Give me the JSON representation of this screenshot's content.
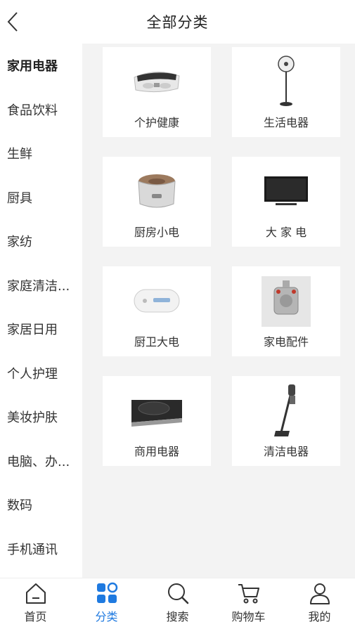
{
  "header": {
    "title": "全部分类"
  },
  "sidebar": {
    "items": [
      {
        "label": "家用电器"
      },
      {
        "label": "食品饮料"
      },
      {
        "label": "生鲜"
      },
      {
        "label": "厨具"
      },
      {
        "label": "家纺"
      },
      {
        "label": "家庭清洁..."
      },
      {
        "label": "家居日用"
      },
      {
        "label": "个人护理"
      },
      {
        "label": "美妆护肤"
      },
      {
        "label": "电脑、办..."
      },
      {
        "label": "数码"
      },
      {
        "label": "手机通讯"
      }
    ],
    "active_index": 0
  },
  "categories": [
    {
      "label": "个护健康",
      "icon": "massager-icon"
    },
    {
      "label": "生活电器",
      "icon": "fan-icon"
    },
    {
      "label": "厨房小电",
      "icon": "rice-cooker-icon"
    },
    {
      "label": "大 家 电",
      "icon": "tv-icon"
    },
    {
      "label": "厨卫大电",
      "icon": "water-heater-icon"
    },
    {
      "label": "家电配件",
      "icon": "appliance-part-icon"
    },
    {
      "label": "商用电器",
      "icon": "induction-cooker-icon"
    },
    {
      "label": "清洁电器",
      "icon": "vacuum-icon"
    }
  ],
  "tabbar": {
    "items": [
      {
        "label": "首页",
        "icon": "home-icon"
      },
      {
        "label": "分类",
        "icon": "category-icon"
      },
      {
        "label": "搜索",
        "icon": "search-icon"
      },
      {
        "label": "购物车",
        "icon": "cart-icon"
      },
      {
        "label": "我的",
        "icon": "user-icon"
      }
    ],
    "active_index": 1
  },
  "colors": {
    "accent": "#1f7ae0",
    "content_bg": "#f3f3f3"
  }
}
